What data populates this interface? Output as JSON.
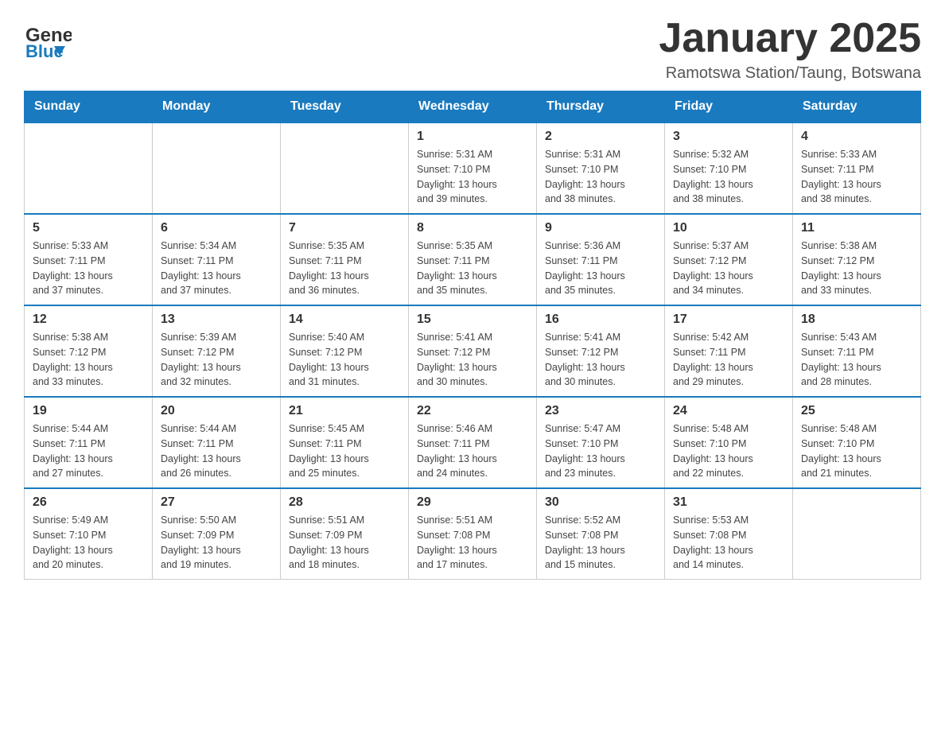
{
  "header": {
    "title": "January 2025",
    "location": "Ramotswa Station/Taung, Botswana"
  },
  "logo": {
    "general": "General",
    "blue": "Blue"
  },
  "days_of_week": [
    "Sunday",
    "Monday",
    "Tuesday",
    "Wednesday",
    "Thursday",
    "Friday",
    "Saturday"
  ],
  "weeks": [
    {
      "days": [
        {
          "number": "",
          "info": ""
        },
        {
          "number": "",
          "info": ""
        },
        {
          "number": "",
          "info": ""
        },
        {
          "number": "1",
          "info": "Sunrise: 5:31 AM\nSunset: 7:10 PM\nDaylight: 13 hours\nand 39 minutes."
        },
        {
          "number": "2",
          "info": "Sunrise: 5:31 AM\nSunset: 7:10 PM\nDaylight: 13 hours\nand 38 minutes."
        },
        {
          "number": "3",
          "info": "Sunrise: 5:32 AM\nSunset: 7:10 PM\nDaylight: 13 hours\nand 38 minutes."
        },
        {
          "number": "4",
          "info": "Sunrise: 5:33 AM\nSunset: 7:11 PM\nDaylight: 13 hours\nand 38 minutes."
        }
      ]
    },
    {
      "days": [
        {
          "number": "5",
          "info": "Sunrise: 5:33 AM\nSunset: 7:11 PM\nDaylight: 13 hours\nand 37 minutes."
        },
        {
          "number": "6",
          "info": "Sunrise: 5:34 AM\nSunset: 7:11 PM\nDaylight: 13 hours\nand 37 minutes."
        },
        {
          "number": "7",
          "info": "Sunrise: 5:35 AM\nSunset: 7:11 PM\nDaylight: 13 hours\nand 36 minutes."
        },
        {
          "number": "8",
          "info": "Sunrise: 5:35 AM\nSunset: 7:11 PM\nDaylight: 13 hours\nand 35 minutes."
        },
        {
          "number": "9",
          "info": "Sunrise: 5:36 AM\nSunset: 7:11 PM\nDaylight: 13 hours\nand 35 minutes."
        },
        {
          "number": "10",
          "info": "Sunrise: 5:37 AM\nSunset: 7:12 PM\nDaylight: 13 hours\nand 34 minutes."
        },
        {
          "number": "11",
          "info": "Sunrise: 5:38 AM\nSunset: 7:12 PM\nDaylight: 13 hours\nand 33 minutes."
        }
      ]
    },
    {
      "days": [
        {
          "number": "12",
          "info": "Sunrise: 5:38 AM\nSunset: 7:12 PM\nDaylight: 13 hours\nand 33 minutes."
        },
        {
          "number": "13",
          "info": "Sunrise: 5:39 AM\nSunset: 7:12 PM\nDaylight: 13 hours\nand 32 minutes."
        },
        {
          "number": "14",
          "info": "Sunrise: 5:40 AM\nSunset: 7:12 PM\nDaylight: 13 hours\nand 31 minutes."
        },
        {
          "number": "15",
          "info": "Sunrise: 5:41 AM\nSunset: 7:12 PM\nDaylight: 13 hours\nand 30 minutes."
        },
        {
          "number": "16",
          "info": "Sunrise: 5:41 AM\nSunset: 7:12 PM\nDaylight: 13 hours\nand 30 minutes."
        },
        {
          "number": "17",
          "info": "Sunrise: 5:42 AM\nSunset: 7:11 PM\nDaylight: 13 hours\nand 29 minutes."
        },
        {
          "number": "18",
          "info": "Sunrise: 5:43 AM\nSunset: 7:11 PM\nDaylight: 13 hours\nand 28 minutes."
        }
      ]
    },
    {
      "days": [
        {
          "number": "19",
          "info": "Sunrise: 5:44 AM\nSunset: 7:11 PM\nDaylight: 13 hours\nand 27 minutes."
        },
        {
          "number": "20",
          "info": "Sunrise: 5:44 AM\nSunset: 7:11 PM\nDaylight: 13 hours\nand 26 minutes."
        },
        {
          "number": "21",
          "info": "Sunrise: 5:45 AM\nSunset: 7:11 PM\nDaylight: 13 hours\nand 25 minutes."
        },
        {
          "number": "22",
          "info": "Sunrise: 5:46 AM\nSunset: 7:11 PM\nDaylight: 13 hours\nand 24 minutes."
        },
        {
          "number": "23",
          "info": "Sunrise: 5:47 AM\nSunset: 7:10 PM\nDaylight: 13 hours\nand 23 minutes."
        },
        {
          "number": "24",
          "info": "Sunrise: 5:48 AM\nSunset: 7:10 PM\nDaylight: 13 hours\nand 22 minutes."
        },
        {
          "number": "25",
          "info": "Sunrise: 5:48 AM\nSunset: 7:10 PM\nDaylight: 13 hours\nand 21 minutes."
        }
      ]
    },
    {
      "days": [
        {
          "number": "26",
          "info": "Sunrise: 5:49 AM\nSunset: 7:10 PM\nDaylight: 13 hours\nand 20 minutes."
        },
        {
          "number": "27",
          "info": "Sunrise: 5:50 AM\nSunset: 7:09 PM\nDaylight: 13 hours\nand 19 minutes."
        },
        {
          "number": "28",
          "info": "Sunrise: 5:51 AM\nSunset: 7:09 PM\nDaylight: 13 hours\nand 18 minutes."
        },
        {
          "number": "29",
          "info": "Sunrise: 5:51 AM\nSunset: 7:08 PM\nDaylight: 13 hours\nand 17 minutes."
        },
        {
          "number": "30",
          "info": "Sunrise: 5:52 AM\nSunset: 7:08 PM\nDaylight: 13 hours\nand 15 minutes."
        },
        {
          "number": "31",
          "info": "Sunrise: 5:53 AM\nSunset: 7:08 PM\nDaylight: 13 hours\nand 14 minutes."
        },
        {
          "number": "",
          "info": ""
        }
      ]
    }
  ]
}
